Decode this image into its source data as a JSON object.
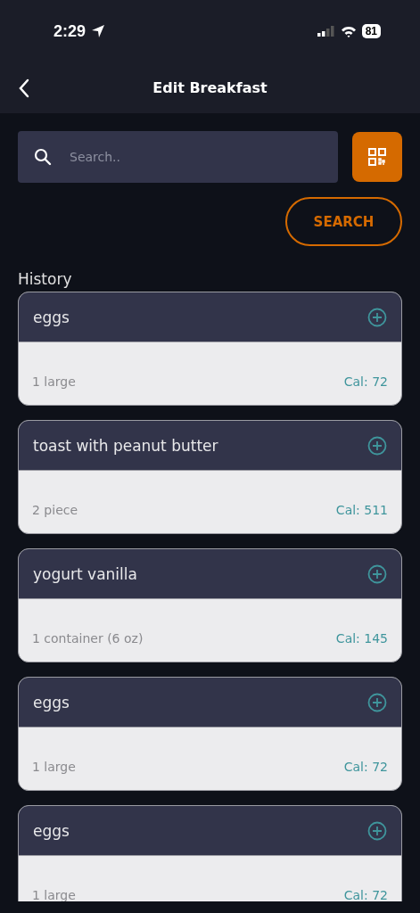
{
  "status_bar": {
    "time": "2:29",
    "battery": "81"
  },
  "header": {
    "title": "Edit Breakfast"
  },
  "search": {
    "placeholder": "Search..",
    "button": "SEARCH"
  },
  "history": {
    "title": "History",
    "items": [
      {
        "name": "eggs",
        "serving": "1 large",
        "calories": "Cal: 72"
      },
      {
        "name": "toast with peanut butter",
        "serving": "2 piece",
        "calories": "Cal: 511"
      },
      {
        "name": "yogurt vanilla",
        "serving": "1 container (6 oz)",
        "calories": "Cal: 145"
      },
      {
        "name": "eggs",
        "serving": "1 large",
        "calories": "Cal: 72"
      },
      {
        "name": "eggs",
        "serving": "1 large",
        "calories": "Cal: 72"
      }
    ]
  }
}
